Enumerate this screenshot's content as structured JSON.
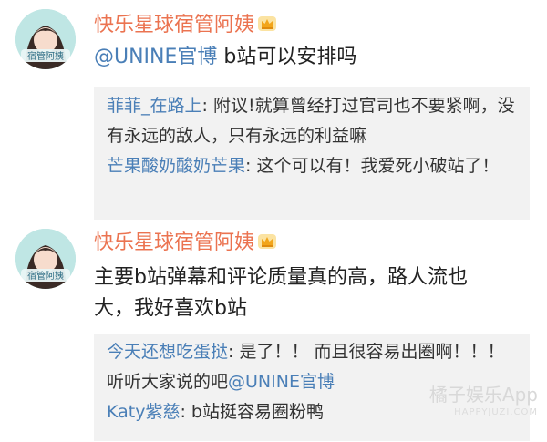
{
  "posts": [
    {
      "author": "快乐星球宿管阿姨",
      "avatar_text": "宿管阿姨",
      "mention": "@UNINE官博",
      "text": " b站可以安排吗",
      "comments": [
        {
          "user": "菲菲_在路上",
          "text": ": 附议!就算曾经打过官司也不要紧啊，没有永远的敌人，只有永远的利益嘛"
        },
        {
          "user": "芒果酸奶酸奶芒果",
          "text": ": 这个可以有！我爱死小破站了！"
        }
      ]
    },
    {
      "author": "快乐星球宿管阿姨",
      "avatar_text": "宿管阿姨",
      "text": "主要b站弹幕和评论质量真的高，路人流也大，我好喜欢b站",
      "comments": [
        {
          "user": "今天还想吃蛋挞",
          "text": ": 是了！！ 而且很容易出圈啊！！！ 听听大家说的吧",
          "mention": "@UNINE官博"
        },
        {
          "user": "Katy紫慈",
          "text": ": b站挺容易圈粉鸭"
        }
      ]
    }
  ],
  "watermark": {
    "main": "橘子娱乐App",
    "sub": "HAPPYJUZI.COM"
  },
  "colors": {
    "author": "#eb7350",
    "link": "#4a7fb7",
    "comment_bg": "#f2f2f2"
  },
  "icons": [
    "crown-icon",
    "avatar"
  ]
}
